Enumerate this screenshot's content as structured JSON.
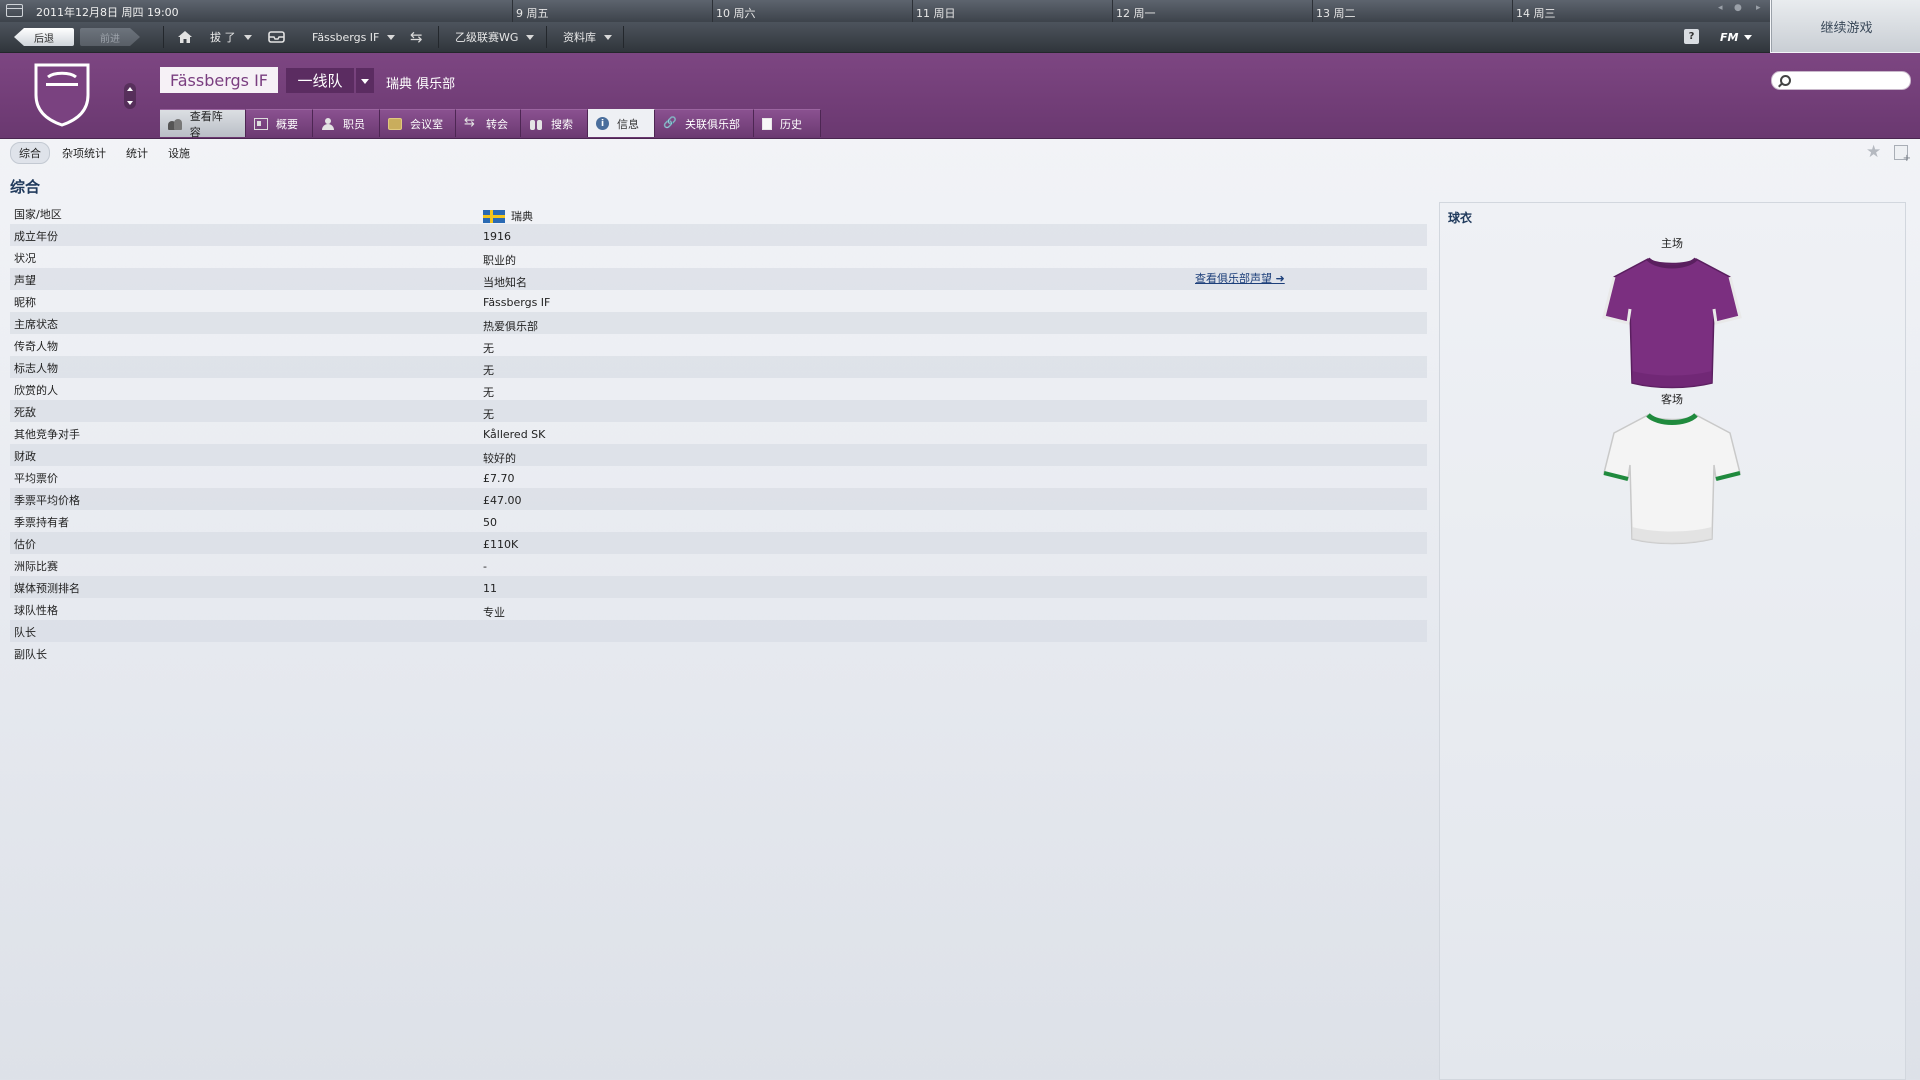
{
  "datebar": {
    "current": "2011年12月8日 周四 19:00",
    "days": [
      "9 周五",
      "10 周六",
      "11 周日",
      "12 周一",
      "13 周二",
      "14 周三"
    ]
  },
  "continue_label": "继续游戏",
  "toolbar": {
    "back": "后退",
    "forward": "前进",
    "menu1": "拔 了",
    "club_menu": "Fässbergs IF",
    "league_menu": "乙级联赛WG",
    "database_menu": "资料库",
    "help": "?",
    "fm": "FM"
  },
  "club": {
    "name": "Fässbergs IF",
    "squad": "一线队",
    "subtitle": "瑞典 俱乐部",
    "colors": {
      "primary": "#7a4280",
      "secondary": "#ffffff"
    }
  },
  "tabs": [
    "查看阵容",
    "概要",
    "职员",
    "会议室",
    "转会",
    "搜索",
    "信息",
    "关联俱乐部",
    "历史"
  ],
  "subtabs": [
    "综合",
    "杂项统计",
    "统计",
    "设施"
  ],
  "section_title": "综合",
  "info_rows": [
    {
      "label": "国家/地区",
      "value": "瑞典"
    },
    {
      "label": "成立年份",
      "value": "1916"
    },
    {
      "label": "状况",
      "value": "职业的"
    },
    {
      "label": "声望",
      "value": "当地知名"
    },
    {
      "label": "昵称",
      "value": "Fässbergs IF"
    },
    {
      "label": "主席状态",
      "value": "热爱俱乐部"
    },
    {
      "label": "传奇人物",
      "value": "无"
    },
    {
      "label": "标志人物",
      "value": "无"
    },
    {
      "label": "欣赏的人",
      "value": "无"
    },
    {
      "label": "死敌",
      "value": "无"
    },
    {
      "label": "其他竞争对手",
      "value": "Kållered SK"
    },
    {
      "label": "财政",
      "value": "较好的"
    },
    {
      "label": "平均票价",
      "value": "£7.70"
    },
    {
      "label": "季票平均价格",
      "value": "£47.00"
    },
    {
      "label": "季票持有者",
      "value": "50"
    },
    {
      "label": "估价",
      "value": "£110K"
    },
    {
      "label": "洲际比赛",
      "value": "-"
    },
    {
      "label": "媒体预测排名",
      "value": "11"
    },
    {
      "label": "球队性格",
      "value": "专业"
    },
    {
      "label": "队长",
      "value": ""
    },
    {
      "label": "副队长",
      "value": ""
    }
  ],
  "reputation_link": "查看俱乐部声望 ➜",
  "kits": {
    "title": "球衣",
    "home_label": "主场",
    "away_label": "客场",
    "home_color": "#7b2f80",
    "away_color": "#f4f4f4",
    "away_trim": "#1f8a3d"
  }
}
